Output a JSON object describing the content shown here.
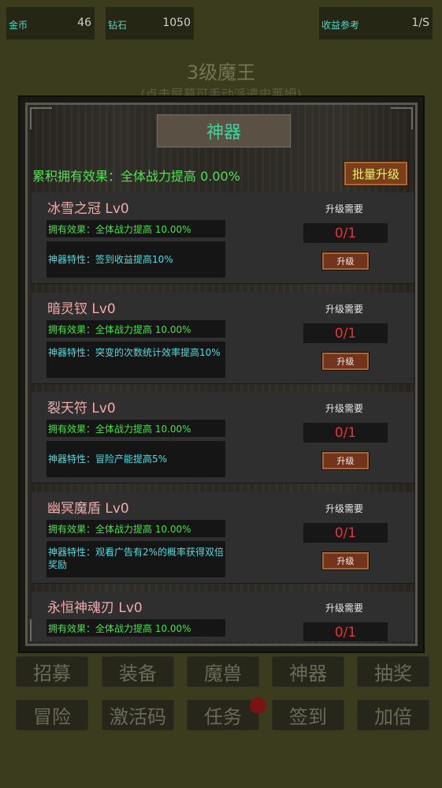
{
  "resources": {
    "gold": {
      "label": "金币",
      "value": "46"
    },
    "diamond": {
      "label": "钻石",
      "value": "1050"
    },
    "income": {
      "label": "收益参考",
      "value": "1/S"
    }
  },
  "stage": {
    "title": "3级魔王",
    "subtitle": "(点击屏幕可手动派遣史莱姆)"
  },
  "modal": {
    "title": "神器",
    "summary": "累积拥有效果：全体战力提高 0.00%",
    "batch_upgrade": "批量升级",
    "need_label": "升级需要",
    "upgrade_label": "升级"
  },
  "artifacts": [
    {
      "name": "冰雪之冠 Lv0",
      "effect": "拥有效果：全体战力提高 10.00%",
      "trait": "神器特性：签到收益提高10%",
      "need": "0/1"
    },
    {
      "name": "暗灵钗 Lv0",
      "effect": "拥有效果：全体战力提高 10.00%",
      "trait": "神器特性：突变的次数统计效率提高10%",
      "need": "0/1"
    },
    {
      "name": "裂天符 Lv0",
      "effect": "拥有效果：全体战力提高 10.00%",
      "trait": "神器特性：冒险产能提高5%",
      "need": "0/1"
    },
    {
      "name": "幽冥魔盾 Lv0",
      "effect": "拥有效果：全体战力提高 10.00%",
      "trait": "神器特性：观看广告有2%的概率获得双倍奖励",
      "need": "0/1"
    },
    {
      "name": "永恒神魂刃 Lv0",
      "effect": "拥有效果：全体战力提高 10.00%",
      "trait": "",
      "need": "0/1"
    }
  ],
  "nav": {
    "row1": [
      "招募",
      "装备",
      "魔兽",
      "神器",
      "抽奖"
    ],
    "row2": [
      "冒险",
      "激活码",
      "任务",
      "签到",
      "加倍"
    ]
  }
}
